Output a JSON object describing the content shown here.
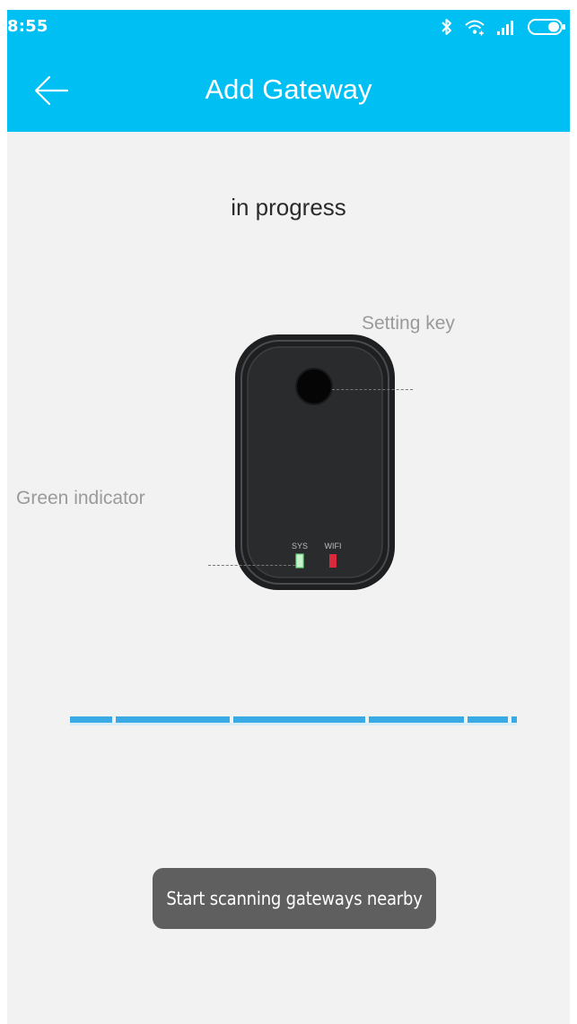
{
  "status_bar": {
    "time": "8:55",
    "icons": [
      "bluetooth-icon",
      "wifi-icon",
      "cellular-signal-icon",
      "battery-icon"
    ]
  },
  "app_bar": {
    "title": "Add Gateway",
    "back_icon": "arrow-left-icon",
    "background_color": "#00bff3"
  },
  "main": {
    "status_text": "in progress",
    "device": {
      "setting_key_label": "Setting key",
      "green_indicator_label": "Green indicator",
      "led_labels": [
        "SYS",
        "WIFI"
      ]
    },
    "scanning_progress_color": "#3aaae5"
  },
  "toast": {
    "message": "Start scanning gateways nearby"
  }
}
